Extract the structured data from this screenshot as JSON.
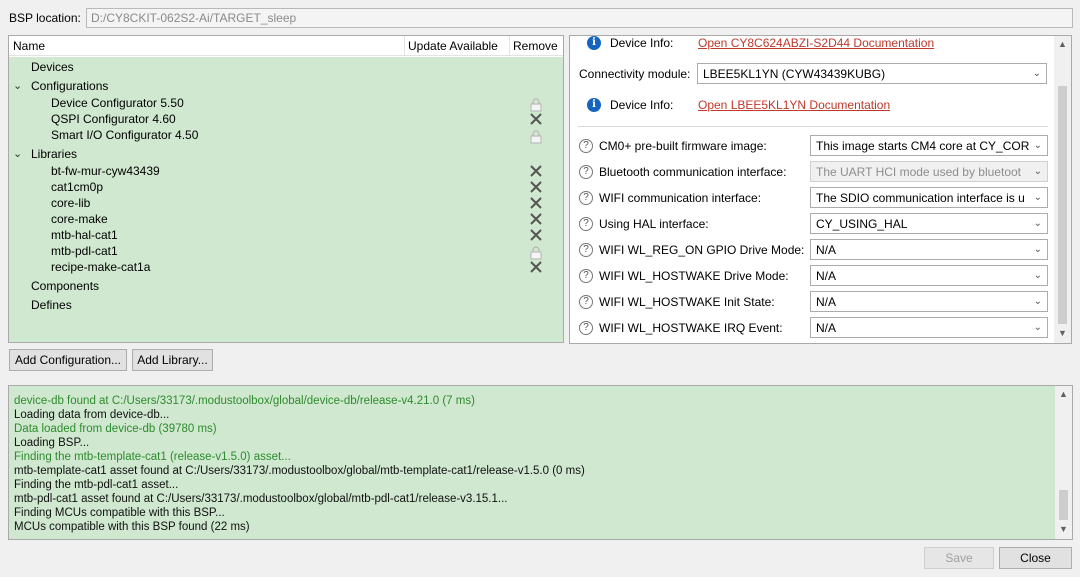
{
  "bsp": {
    "label": "BSP location:",
    "path": "D:/CY8CKIT-062S2-Ai/TARGET_sleep"
  },
  "tree": {
    "headers": {
      "name": "Name",
      "update": "Update Available",
      "remove": "Remove"
    },
    "devices": "Devices",
    "configurations": {
      "label": "Configurations",
      "items": [
        "Device Configurator 5.50",
        "QSPI Configurator 4.60",
        "Smart I/O Configurator 4.50"
      ]
    },
    "libraries": {
      "label": "Libraries",
      "items": [
        "bt-fw-mur-cyw43439",
        "cat1cm0p",
        "core-lib",
        "core-make",
        "mtb-hal-cat1",
        "mtb-pdl-cat1",
        "recipe-make-cat1a"
      ]
    },
    "components": "Components",
    "defines": "Defines"
  },
  "buttons": {
    "add_configuration": "Add Configuration...",
    "add_library": "Add Library...",
    "save": "Save",
    "close": "Close"
  },
  "settings": {
    "device_info_label": "Device Info:",
    "device_info_link": "Open CY8C624ABZI-S2D44 Documentation",
    "connectivity_label": "Connectivity module:",
    "connectivity_value": "LBEE5KL1YN (CYW43439KUBG)",
    "module_info_label": "Device Info:",
    "module_info_link": "Open LBEE5KL1YN Documentation",
    "rows": [
      {
        "label": "CM0+ pre-built firmware image:",
        "value": "This image starts CM4 core at CY_COR"
      },
      {
        "label": "Bluetooth communication interface:",
        "value": "The UART HCI mode used by bluetoot"
      },
      {
        "label": "WIFI communication interface:",
        "value": "The SDIO communication interface is u"
      },
      {
        "label": "Using HAL interface:",
        "value": "CY_USING_HAL"
      },
      {
        "label": "WIFI WL_REG_ON GPIO Drive Mode:",
        "value": "N/A"
      },
      {
        "label": "WIFI WL_HOSTWAKE Drive Mode:",
        "value": "N/A"
      },
      {
        "label": "WIFI WL_HOSTWAKE Init State:",
        "value": "N/A"
      },
      {
        "label": "WIFI WL_HOSTWAKE IRQ Event:",
        "value": "N/A"
      }
    ]
  },
  "log": [
    "device-db found at C:/Users/33173/.modustoolbox/global/device-db/release-v4.21.0 (7 ms)",
    "Loading data from device-db...",
    "Data loaded from device-db (39780 ms)",
    "Loading BSP...",
    "Finding the mtb-template-cat1 (release-v1.5.0) asset...",
    "mtb-template-cat1 asset found at C:/Users/33173/.modustoolbox/global/mtb-template-cat1/release-v1.5.0 (0 ms)",
    "Finding the mtb-pdl-cat1 asset...",
    "mtb-pdl-cat1 asset found at C:/Users/33173/.modustoolbox/global/mtb-pdl-cat1/release-v3.15.1...",
    "Finding MCUs compatible with this BSP...",
    "MCUs compatible with this BSP found (22 ms)"
  ]
}
